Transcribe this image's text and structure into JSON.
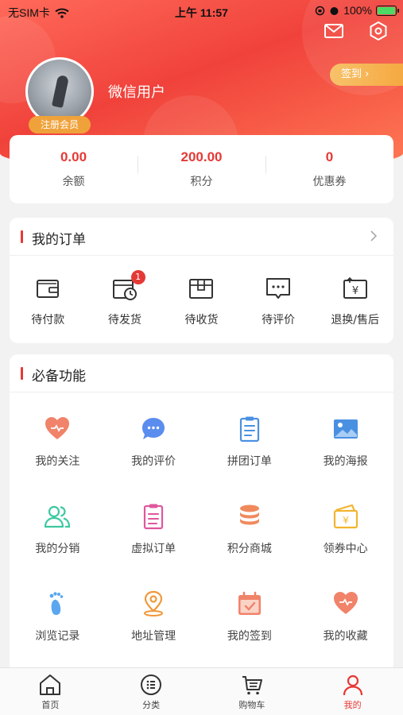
{
  "status_bar": {
    "carrier": "无SIM卡",
    "time": "上午 11:57",
    "battery": "100%"
  },
  "profile": {
    "username": "微信用户",
    "member_badge": "注册会员",
    "checkin_label": "签到 ›"
  },
  "stats": [
    {
      "value": "0.00",
      "label": "余额"
    },
    {
      "value": "200.00",
      "label": "积分"
    },
    {
      "value": "0",
      "label": "优惠券"
    }
  ],
  "orders": {
    "title": "我的订单",
    "items": [
      {
        "label": "待付款",
        "icon": "wallet-icon"
      },
      {
        "label": "待发货",
        "icon": "pending-ship-icon",
        "badge": "1"
      },
      {
        "label": "待收货",
        "icon": "package-icon"
      },
      {
        "label": "待评价",
        "icon": "comment-icon"
      },
      {
        "label": "退换/售后",
        "icon": "refund-icon"
      }
    ]
  },
  "functions": {
    "title": "必备功能",
    "items": [
      {
        "label": "我的关注",
        "icon": "heart-icon",
        "color": "#f0836a"
      },
      {
        "label": "我的评价",
        "icon": "chat-bubble-icon",
        "color": "#5b8def"
      },
      {
        "label": "拼团订单",
        "icon": "clipboard-icon",
        "color": "#4a90e2"
      },
      {
        "label": "我的海报",
        "icon": "image-icon",
        "color": "#4a90e2"
      },
      {
        "label": "我的分销",
        "icon": "users-icon",
        "color": "#3cc8a0"
      },
      {
        "label": "虚拟订单",
        "icon": "list-icon",
        "color": "#e0569e"
      },
      {
        "label": "积分商城",
        "icon": "coins-icon",
        "color": "#f08a5d"
      },
      {
        "label": "领券中心",
        "icon": "coupon-wallet-icon",
        "color": "#f2b530"
      },
      {
        "label": "浏览记录",
        "icon": "footprint-icon",
        "color": "#5aa7f0"
      },
      {
        "label": "地址管理",
        "icon": "location-icon",
        "color": "#f0983a"
      },
      {
        "label": "我的签到",
        "icon": "calendar-check-icon",
        "color": "#f0836a"
      },
      {
        "label": "我的收藏",
        "icon": "heart-fav-icon",
        "color": "#f0836a"
      }
    ]
  },
  "tabbar": {
    "tabs": [
      {
        "label": "首页",
        "icon": "home-icon"
      },
      {
        "label": "分类",
        "icon": "category-icon"
      },
      {
        "label": "购物车",
        "icon": "cart-icon"
      },
      {
        "label": "我的",
        "icon": "user-icon",
        "active": true
      }
    ]
  },
  "colors": {
    "accent": "#e53935",
    "hero": "#f0423b",
    "badge": "#f0a23a"
  }
}
